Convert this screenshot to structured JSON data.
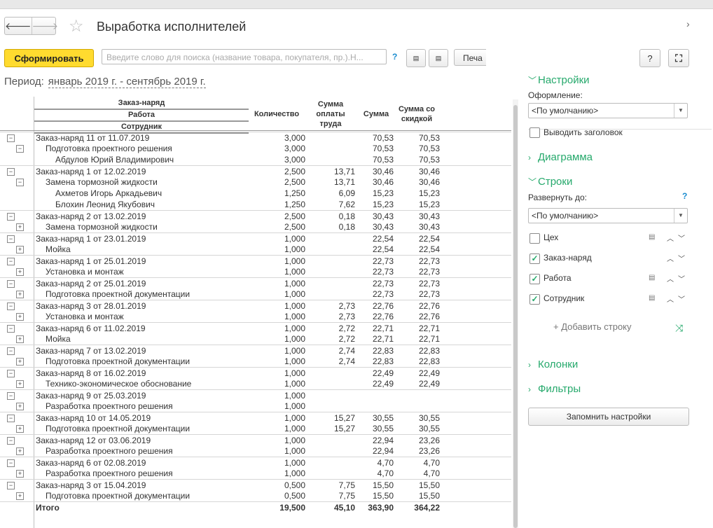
{
  "window": {
    "title": "Выработка исполнителей"
  },
  "toolbar": {
    "generate_label": "Сформировать",
    "search_placeholder": "Введите слово для поиска (название товара, покупателя, пр.).Н...",
    "search_help": "?",
    "print_label": "Печа",
    "help_label": "?"
  },
  "period": {
    "label": "Период:",
    "value": "январь 2019 г. - сентябрь 2019 г."
  },
  "report": {
    "group_headers": [
      "Заказ-наряд",
      "Работа",
      "Сотрудник"
    ],
    "columns": [
      "Количество",
      "Сумма оплаты труда",
      "Сумма",
      "Сумма со скидкой"
    ],
    "rows": [
      {
        "level": 0,
        "name": "Заказ-наряд 11 от 11.07.2019",
        "q": "3,000",
        "p": "",
        "s": "70,53",
        "d": "70,53",
        "icon": "−"
      },
      {
        "level": 1,
        "name": "Подготовка проектного решения",
        "q": "3,000",
        "p": "",
        "s": "70,53",
        "d": "70,53",
        "icon": "−"
      },
      {
        "level": 2,
        "name": "Абдулов Юрий Владимирович",
        "q": "3,000",
        "p": "",
        "s": "70,53",
        "d": "70,53",
        "icon": ""
      },
      {
        "level": 0,
        "name": "Заказ-наряд 1 от 12.02.2019",
        "q": "2,500",
        "p": "13,71",
        "s": "30,46",
        "d": "30,46",
        "icon": "−"
      },
      {
        "level": 1,
        "name": "Замена тормозной жидкости",
        "q": "2,500",
        "p": "13,71",
        "s": "30,46",
        "d": "30,46",
        "icon": "−"
      },
      {
        "level": 2,
        "name": "Ахметов Игорь Аркадьевич",
        "q": "1,250",
        "p": "6,09",
        "s": "15,23",
        "d": "15,23",
        "icon": ""
      },
      {
        "level": 2,
        "name": "Блохин Леонид Якубович",
        "q": "1,250",
        "p": "7,62",
        "s": "15,23",
        "d": "15,23",
        "icon": ""
      },
      {
        "level": 0,
        "name": "Заказ-наряд 2 от 13.02.2019",
        "q": "2,500",
        "p": "0,18",
        "s": "30,43",
        "d": "30,43",
        "icon": "−"
      },
      {
        "level": 1,
        "name": "Замена тормозной жидкости",
        "q": "2,500",
        "p": "0,18",
        "s": "30,43",
        "d": "30,43",
        "icon": "+"
      },
      {
        "level": 0,
        "name": "Заказ-наряд 1 от 23.01.2019",
        "q": "1,000",
        "p": "",
        "s": "22,54",
        "d": "22,54",
        "icon": "−"
      },
      {
        "level": 1,
        "name": "Мойка",
        "q": "1,000",
        "p": "",
        "s": "22,54",
        "d": "22,54",
        "icon": "+"
      },
      {
        "level": 0,
        "name": "Заказ-наряд 1 от 25.01.2019",
        "q": "1,000",
        "p": "",
        "s": "22,73",
        "d": "22,73",
        "icon": "−"
      },
      {
        "level": 1,
        "name": "Установка и монтаж",
        "q": "1,000",
        "p": "",
        "s": "22,73",
        "d": "22,73",
        "icon": "+"
      },
      {
        "level": 0,
        "name": "Заказ-наряд 2 от 25.01.2019",
        "q": "1,000",
        "p": "",
        "s": "22,73",
        "d": "22,73",
        "icon": "−"
      },
      {
        "level": 1,
        "name": "Подготовка проектной документации",
        "q": "1,000",
        "p": "",
        "s": "22,73",
        "d": "22,73",
        "icon": "+"
      },
      {
        "level": 0,
        "name": "Заказ-наряд 3 от 28.01.2019",
        "q": "1,000",
        "p": "2,73",
        "s": "22,76",
        "d": "22,76",
        "icon": "−"
      },
      {
        "level": 1,
        "name": "Установка и монтаж",
        "q": "1,000",
        "p": "2,73",
        "s": "22,76",
        "d": "22,76",
        "icon": "+"
      },
      {
        "level": 0,
        "name": "Заказ-наряд 6 от 11.02.2019",
        "q": "1,000",
        "p": "2,72",
        "s": "22,71",
        "d": "22,71",
        "icon": "−"
      },
      {
        "level": 1,
        "name": "Мойка",
        "q": "1,000",
        "p": "2,72",
        "s": "22,71",
        "d": "22,71",
        "icon": "+"
      },
      {
        "level": 0,
        "name": "Заказ-наряд 7 от 13.02.2019",
        "q": "1,000",
        "p": "2,74",
        "s": "22,83",
        "d": "22,83",
        "icon": "−"
      },
      {
        "level": 1,
        "name": "Подготовка проектной документации",
        "q": "1,000",
        "p": "2,74",
        "s": "22,83",
        "d": "22,83",
        "icon": "+"
      },
      {
        "level": 0,
        "name": "Заказ-наряд 8 от 16.02.2019",
        "q": "1,000",
        "p": "",
        "s": "22,49",
        "d": "22,49",
        "icon": "−"
      },
      {
        "level": 1,
        "name": "Технико-экономическое обоснование",
        "q": "1,000",
        "p": "",
        "s": "22,49",
        "d": "22,49",
        "icon": "+"
      },
      {
        "level": 0,
        "name": "Заказ-наряд 9 от 25.03.2019",
        "q": "1,000",
        "p": "",
        "s": "",
        "d": "",
        "icon": "−"
      },
      {
        "level": 1,
        "name": "Разработка проектного решения",
        "q": "1,000",
        "p": "",
        "s": "",
        "d": "",
        "icon": "+"
      },
      {
        "level": 0,
        "name": "Заказ-наряд 10 от 14.05.2019",
        "q": "1,000",
        "p": "15,27",
        "s": "30,55",
        "d": "30,55",
        "icon": "−"
      },
      {
        "level": 1,
        "name": "Подготовка проектной документации",
        "q": "1,000",
        "p": "15,27",
        "s": "30,55",
        "d": "30,55",
        "icon": "+"
      },
      {
        "level": 0,
        "name": "Заказ-наряд 12 от 03.06.2019",
        "q": "1,000",
        "p": "",
        "s": "22,94",
        "d": "23,26",
        "icon": "−"
      },
      {
        "level": 1,
        "name": "Разработка проектного решения",
        "q": "1,000",
        "p": "",
        "s": "22,94",
        "d": "23,26",
        "icon": "+"
      },
      {
        "level": 0,
        "name": "Заказ-наряд 6 от 02.08.2019",
        "q": "1,000",
        "p": "",
        "s": "4,70",
        "d": "4,70",
        "icon": "−"
      },
      {
        "level": 1,
        "name": "Разработка проектного решения",
        "q": "1,000",
        "p": "",
        "s": "4,70",
        "d": "4,70",
        "icon": "+"
      },
      {
        "level": 0,
        "name": "Заказ-наряд 3 от 15.04.2019",
        "q": "0,500",
        "p": "7,75",
        "s": "15,50",
        "d": "15,50",
        "icon": "−"
      },
      {
        "level": 1,
        "name": "Подготовка проектной документации",
        "q": "0,500",
        "p": "7,75",
        "s": "15,50",
        "d": "15,50",
        "icon": "+"
      }
    ],
    "total": {
      "name": "Итого",
      "q": "19,500",
      "p": "45,10",
      "s": "363,90",
      "d": "364,22"
    }
  },
  "settings": {
    "section_settings": "Настройки",
    "design_label": "Оформление:",
    "design_value": "<По умолчанию>",
    "show_header_label": "Выводить заголовок",
    "section_chart": "Диаграмма",
    "section_rows": "Строки",
    "expand_label": "Развернуть до:",
    "expand_help": "?",
    "expand_value": "<По умолчанию>",
    "groupings": [
      {
        "label": "Цех",
        "checked": false,
        "has_list_icon": true
      },
      {
        "label": "Заказ-наряд",
        "checked": true,
        "has_list_icon": false
      },
      {
        "label": "Работа",
        "checked": true,
        "has_list_icon": true
      },
      {
        "label": "Сотрудник",
        "checked": true,
        "has_list_icon": true
      }
    ],
    "add_row_label": "+ Добавить строку",
    "section_columns": "Колонки",
    "section_filters": "Фильтры",
    "save_label": "Запомнить настройки"
  }
}
